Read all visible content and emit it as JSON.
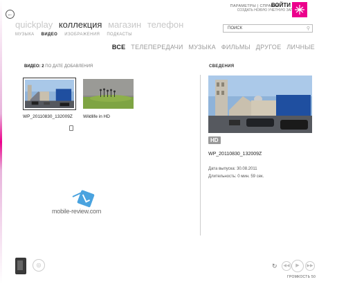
{
  "header": {
    "settings": "ПАРАМЕТРЫ",
    "separator": "|",
    "help": "СПРАВКА",
    "signin": "ВОЙТИ",
    "create_account": "СОЗДАТЬ НОВУЮ УЧЕТНУЮ ЗАПИСЬ"
  },
  "main_nav": [
    "quickplay",
    "коллекция",
    "магазин",
    "телефон"
  ],
  "sub_nav": [
    "МУЗЫКА",
    "ВИДЕО",
    "ИЗОБРАЖЕНИЯ",
    "ПОДКАСТЫ"
  ],
  "search": {
    "placeholder": "ПОИСК"
  },
  "filters": [
    "ВСЕ",
    "ТЕЛЕПЕРЕДАЧИ",
    "МУЗЫКА",
    "ФИЛЬМЫ",
    "ДРУГОЕ",
    "ЛИЧНЫЕ"
  ],
  "videos": {
    "label": "ВИДЕО: 2",
    "sort": "ПО ДАТЕ ДОБАВЛЕНИЯ",
    "items": [
      {
        "title": "WP_20110830_132009Z"
      },
      {
        "title": "Wildlife in HD"
      }
    ]
  },
  "watermark": "mobile-review.com",
  "details": {
    "heading": "СВЕДЕНИЯ",
    "badge": "HD",
    "title": "WP_20110830_132009Z",
    "release": "Дата выпуска: 30.08.2011",
    "duration": "Длительность: 0 мин. 59 сек."
  },
  "player": {
    "volume": "ГРОМКОСТЬ 50"
  },
  "colors": {
    "accent": "#ec008c"
  }
}
